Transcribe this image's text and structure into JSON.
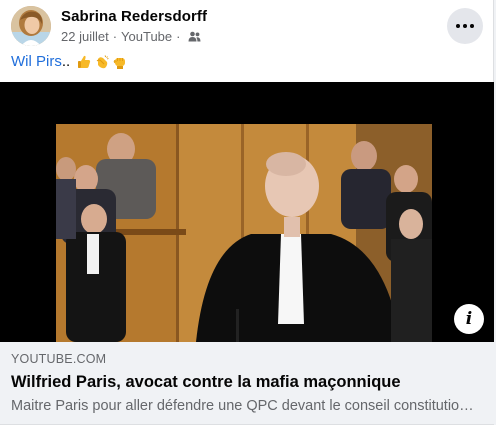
{
  "post": {
    "author": "Sabrina Redersdorff",
    "date": "22 juillet",
    "source": "YouTube",
    "separator": "·",
    "audience_icon": "friends-icon",
    "more_icon": "more-options-icon"
  },
  "message": {
    "link_text": "Wil Pirs",
    "suffix": "..",
    "emojis": [
      "thumbs-up-emoji",
      "clapping-hands-emoji",
      "raised-fist-emoji"
    ]
  },
  "video": {
    "info_label": "i"
  },
  "preview": {
    "domain": "YOUTUBE.COM",
    "title": "Wilfried Paris, avocat contre la mafia maçonnique",
    "description": "Maitre Paris pour aller défendre une QPC devant le conseil constitutionnel"
  },
  "colors": {
    "link": "#216fdb",
    "secondary_text": "#65676b",
    "preview_bg": "#f0f2f5",
    "more_button_bg": "#e4e6eb"
  }
}
